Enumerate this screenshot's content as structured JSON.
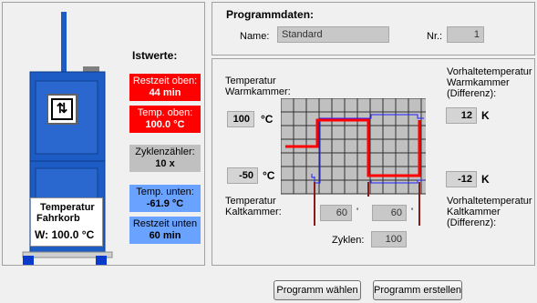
{
  "istwerte": {
    "title": "Istwerte:",
    "restzeit_oben_label": "Restzeit oben:",
    "restzeit_oben_value": "44 min",
    "temp_oben_label": "Temp. oben:",
    "temp_oben_value": "100.0 °C",
    "zyklen_label": "Zyklenzähler:",
    "zyklen_value": "10 x",
    "temp_unten_label": "Temp. unten:",
    "temp_unten_value": "-61.9 °C",
    "restzeit_unten_label": "Restzeit unten",
    "restzeit_unten_value": "60 min"
  },
  "fahrkorb": {
    "title": "Temperatur",
    "subtitle": "Fahrkorb",
    "value": "W:  100.0  °C"
  },
  "programmdaten": {
    "title": "Programmdaten:",
    "name_label": "Name:",
    "name_value": "Standard",
    "nr_label": "Nr.:",
    "nr_value": "1"
  },
  "params": {
    "warm_label_1": "Temperatur",
    "warm_label_2": "Warmkammer:",
    "warm_value": "100",
    "warm_unit": "°C",
    "kalt_value": "-50",
    "kalt_unit": "°C",
    "kalt_label_1": "Temperatur",
    "kalt_label_2": "Kaltkammer:",
    "vorhalt_warm_1": "Vorhaltetemperatur",
    "vorhalt_warm_2": "Warmkammer",
    "vorhalt_warm_3": "(Differenz):",
    "vorhalt_warm_value": "12",
    "vorhalt_warm_unit": "K",
    "vorhalt_kalt_value": "-12",
    "vorhalt_kalt_unit": "K",
    "vorhalt_kalt_1": "Vorhaltetemperatur",
    "vorhalt_kalt_2": "Kaltkammer",
    "vorhalt_kalt_3": "(Differenz):",
    "time_1": "60",
    "time_1_unit": "'",
    "time_2": "60",
    "time_2_unit": "'",
    "zyklen_label": "Zyklen:",
    "zyklen_value": "100"
  },
  "buttons": {
    "waehlen": "Programm wählen",
    "erstellen": "Programm erstellen"
  },
  "colors": {
    "red": "#ff0000",
    "blue": "#2a5caa",
    "lightblue": "#6aa2ff",
    "gray": "#c0c0c0"
  }
}
